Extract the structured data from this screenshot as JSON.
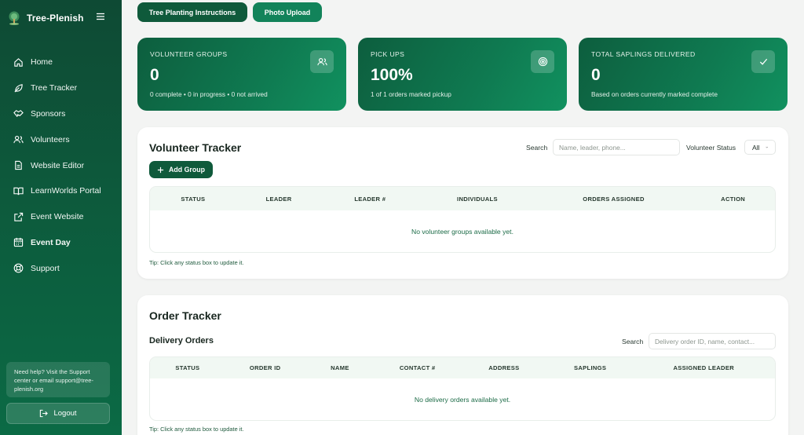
{
  "brand": {
    "name": "Tree-Plenish"
  },
  "sidebar": {
    "items": [
      {
        "label": "Home",
        "icon": "home-icon"
      },
      {
        "label": "Tree Tracker",
        "icon": "leaf-icon"
      },
      {
        "label": "Sponsors",
        "icon": "handshake-icon"
      },
      {
        "label": "Volunteers",
        "icon": "users-icon"
      },
      {
        "label": "Website Editor",
        "icon": "file-icon"
      },
      {
        "label": "LearnWorlds Portal",
        "icon": "book-icon"
      },
      {
        "label": "Event Website",
        "icon": "external-link-icon"
      },
      {
        "label": "Event Day",
        "icon": "calendar-icon"
      },
      {
        "label": "Support",
        "icon": "lifebuoy-icon"
      }
    ],
    "active": "Event Day",
    "help_text": "Need help? Visit the Support center or email support@tree-plenish.org",
    "logout_label": "Logout"
  },
  "top_buttons": {
    "instructions": "Tree Planting Instructions",
    "photo_upload": "Photo Upload"
  },
  "stats": [
    {
      "label": "VOLUNTEER GROUPS",
      "value": "0",
      "sub": "0 complete • 0 in progress • 0 not arrived",
      "icon": "users-icon"
    },
    {
      "label": "PICK UPS",
      "value": "100%",
      "sub": "1 of 1 orders marked pickup",
      "icon": "target-icon"
    },
    {
      "label": "TOTAL SAPLINGS DELIVERED",
      "value": "0",
      "sub": "Based on orders currently marked complete",
      "icon": "check-icon"
    }
  ],
  "volunteer_tracker": {
    "title": "Volunteer Tracker",
    "search_label": "Search",
    "search_placeholder": "Name, leader, phone...",
    "status_label": "Volunteer Status",
    "status_value": "All",
    "add_label": "Add Group",
    "columns": [
      "STATUS",
      "LEADER",
      "LEADER #",
      "INDIVIDUALS",
      "ORDERS ASSIGNED",
      "ACTION"
    ],
    "empty": "No volunteer groups available yet.",
    "tip": "Tip: Click any status box to update it."
  },
  "order_tracker": {
    "title": "Order Tracker",
    "subtitle": "Delivery Orders",
    "search_label": "Search",
    "search_placeholder": "Delivery order ID, name, contact...",
    "columns": [
      "STATUS",
      "ORDER ID",
      "NAME",
      "CONTACT #",
      "ADDRESS",
      "SAPLINGS",
      "ASSIGNED LEADER"
    ],
    "empty": "No delivery orders available yet.",
    "tip": "Tip: Click any status box to update it."
  },
  "colors": {
    "sidebar": "#0d5a3c",
    "accent": "#0f5a3b",
    "stat_card": "#0f7a51"
  }
}
